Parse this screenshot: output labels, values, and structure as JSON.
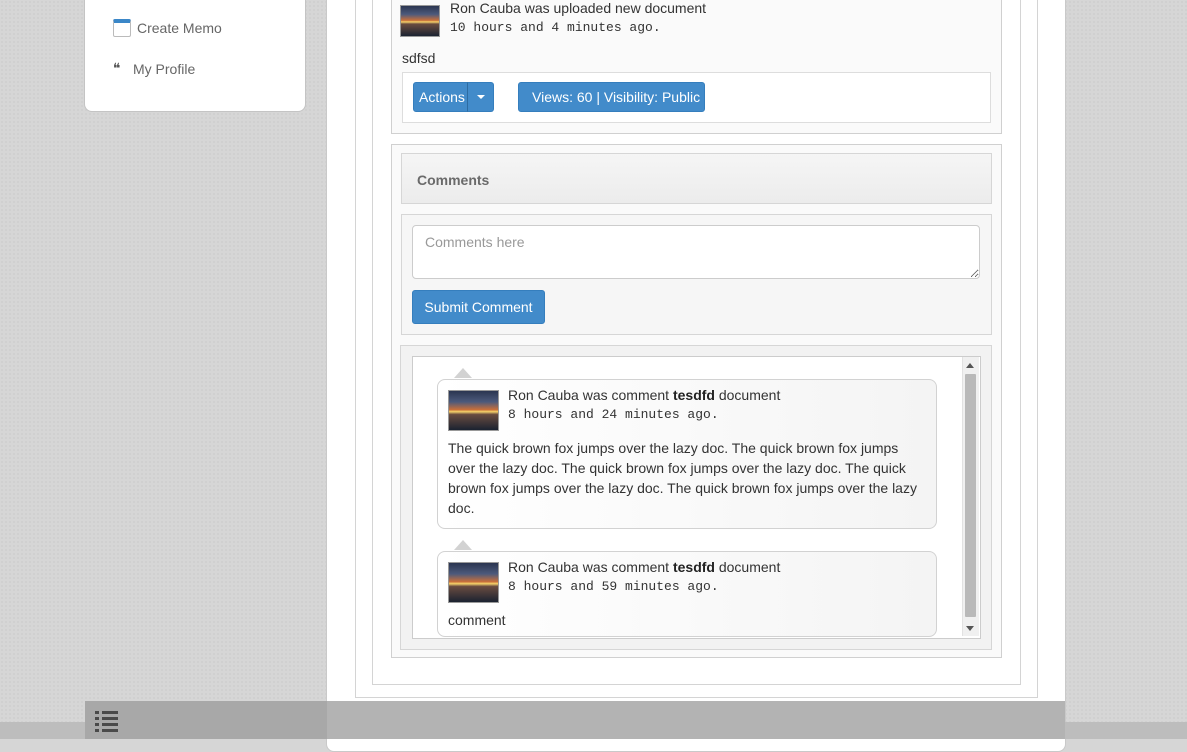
{
  "sidebar": {
    "items": [
      {
        "label": "Create Memo",
        "icon": "memo-icon"
      },
      {
        "label": "My Profile",
        "icon": "profile-quote-icon"
      }
    ]
  },
  "post": {
    "title": "Ron Cauba was uploaded new document",
    "time": "10 hours and 4 minutes ago.",
    "body": "sdfsd",
    "actions_label": "Actions",
    "views_label": "Views: 60 | Visibility: Public"
  },
  "comments": {
    "header": "Comments",
    "placeholder": "Comments here",
    "submit_label": "Submit Comment",
    "items": [
      {
        "prefix": "Ron Cauba was comment ",
        "doc": "tesdfd",
        "suffix": " document",
        "time": "8 hours and 24 minutes ago.",
        "body": "The quick brown fox jumps over the lazy doc. The quick brown fox jumps over the lazy doc. The quick brown fox jumps over the lazy doc. The quick brown fox jumps over the lazy doc. The quick brown fox jumps over the lazy doc."
      },
      {
        "prefix": "Ron Cauba was comment ",
        "doc": "tesdfd",
        "suffix": " document",
        "time": "8 hours and 59 minutes ago.",
        "body": "comment"
      }
    ]
  },
  "bottom_bar": {
    "icon": "list-icon"
  },
  "colors": {
    "accent": "#428bca",
    "page_bg": "#d6d6d6",
    "bottom_bar": "#b3b3b3"
  }
}
